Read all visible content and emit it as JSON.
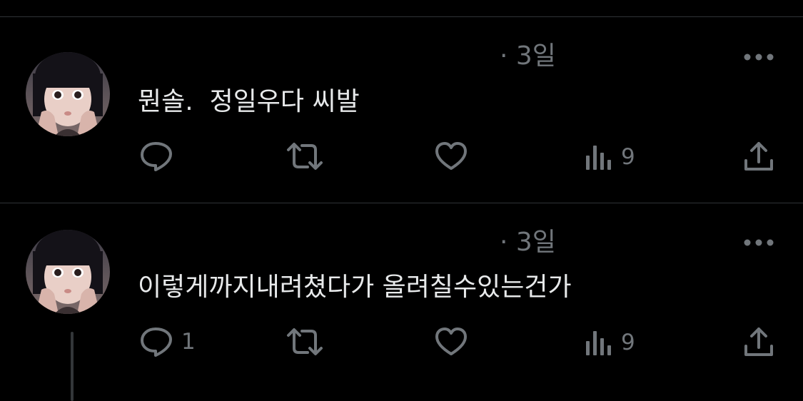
{
  "tweets": [
    {
      "time": "· 3일",
      "text": "뭔솔.  정일우다 씨발",
      "reply_count": "",
      "view_count": "9"
    },
    {
      "time": "· 3일",
      "text": "이렇게까지내려쳤다가 올려칠수있는건가",
      "reply_count": "1",
      "view_count": "9"
    }
  ],
  "colors": {
    "background": "#000000",
    "text": "#e7e9ea",
    "secondary": "#71767b",
    "divider": "#2f3336"
  },
  "icons": [
    "reply-icon",
    "retweet-icon",
    "like-icon",
    "views-icon",
    "share-icon",
    "more-icon"
  ]
}
